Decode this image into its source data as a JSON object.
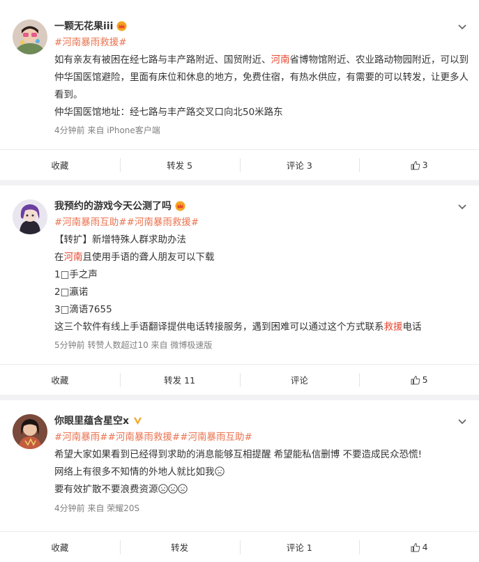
{
  "posts": [
    {
      "nickname": "一颗无花果iii",
      "badge": "crown-icon",
      "hashtag": "#河南暴雨救援#",
      "paragraphs": [
        [
          "如有亲友有被困在经七路与丰产路附近、国贸附近、",
          "河南",
          "省博物馆附近、农业路动物园附近，可以到仲华国医馆避险，里面有床位和休息的地方，免费住宿，有热水供应，有需要的可以转发，让更多人看到。"
        ],
        [
          "仲华国医馆地址：经七路与丰产路交叉口向北50米路东"
        ]
      ],
      "meta": "4分钟前  来自 iPhone客户端",
      "actions": {
        "collect": "收藏",
        "repost": "转发 5",
        "comment": "评论 3",
        "like": "3"
      }
    },
    {
      "nickname": "我预约的游戏今天公测了吗",
      "badge": "crown-icon",
      "hashtags": [
        "#河南暴雨互助#",
        "#河南暴雨救援#"
      ],
      "lines": {
        "l1": "【转扩】新增特殊人群求助办法",
        "l2_pre": "在",
        "l2_hl": "河南",
        "l2_post": "且使用手语的聋人朋友可以下载",
        "l3": "1□手之声",
        "l4": "2□瀛诺",
        "l5": "3□滴语7655",
        "l6_pre": "这三个软件有线上手语翻译提供电话转接服务，遇到困难可以通过这个方式联系",
        "l6_hl": "救援",
        "l6_post": "电话"
      },
      "meta": "5分钟前  转赞人数超过10  来自 微博极速版",
      "actions": {
        "collect": "收藏",
        "repost": "转发 11",
        "comment": "评论",
        "like": "5"
      }
    },
    {
      "nickname": "你眼里蕴含星空x",
      "badge": "verified-v-icon",
      "hashtags": [
        "#河南暴雨#",
        "#河南暴雨救援#",
        "#河南暴雨互助#"
      ],
      "lines": {
        "l1": "希望大家如果看到已经得到求助的消息能够互相提醒 希望能私信删博 不要造成民众恐慌!",
        "l2": "网络上有很多不知情的外地人就比如我",
        "l3": "要有效扩散不要浪费资源"
      },
      "meta": "4分钟前  来自 荣耀20S",
      "actions": {
        "collect": "收藏",
        "repost": "转发",
        "comment": "评论 1",
        "like": "4"
      }
    }
  ],
  "colors": {
    "highlight": "#e8452d",
    "hashtag": "#eb7350",
    "meta": "#808080",
    "background": "#f2f2f5"
  }
}
